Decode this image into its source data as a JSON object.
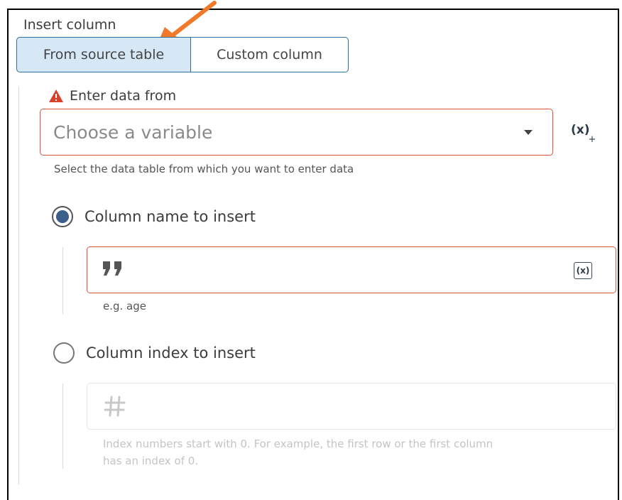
{
  "section": {
    "title": "Insert column"
  },
  "segmented": {
    "options": [
      "From source table",
      "Custom column"
    ],
    "selected": "From source table"
  },
  "enter_data": {
    "label": "Enter data from",
    "select_placeholder": "Choose a variable",
    "helper": "Select the data table from which you want to enter data",
    "variable_button": "(x)",
    "variable_button_sub": "+"
  },
  "column_name": {
    "label": "Column name to insert",
    "selected": true,
    "input_value": "",
    "helper": "e.g. age",
    "variable_button": "(x)"
  },
  "column_index": {
    "label": "Column index to insert",
    "selected": false,
    "input_value": "",
    "helper_line1": "Index numbers start with 0. For example, the first row or the first column",
    "helper_line2": "has an index of 0."
  },
  "colors": {
    "selected_segment_bg": "#d6e7f6",
    "segment_border": "#2c6e9e",
    "error_border": "#d9533a",
    "warning_icon": "#d9412b",
    "arrow": "#f07a2a",
    "radio_selected": "#3b5f8a"
  },
  "icons": [
    "warning-icon",
    "chevron-down-icon",
    "variable-insert-icon",
    "quote-icon",
    "variable-icon",
    "hash-icon",
    "annotation-arrow-icon"
  ]
}
